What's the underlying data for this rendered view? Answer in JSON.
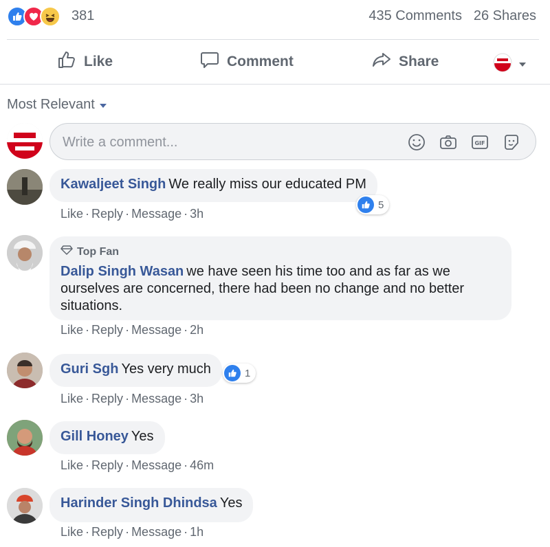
{
  "reactions": {
    "icons": [
      "like-icon",
      "love-icon",
      "haha-icon"
    ],
    "count": "381",
    "comments": "435 Comments",
    "shares": "26 Shares"
  },
  "actions": {
    "like": "Like",
    "comment": "Comment",
    "share": "Share"
  },
  "sort": {
    "label": "Most Relevant"
  },
  "composer": {
    "placeholder": "Write a comment..."
  },
  "comments": [
    {
      "author": "Kawaljeet Singh",
      "text": "We really miss our educated PM",
      "time": "3h",
      "likes": "5",
      "badge": ""
    },
    {
      "author": "Dalip Singh Wasan",
      "badge": "Top Fan",
      "text": "we have seen his time too and as far as we ourselves are concerned, there had been no change and no better situations.",
      "time": "2h",
      "likes": ""
    },
    {
      "author": "Guri Sgh",
      "text": "Yes very much",
      "time": "3h",
      "likes": "1",
      "badge": ""
    },
    {
      "author": "Gill Honey",
      "text": "Yes",
      "time": "46m",
      "likes": "",
      "badge": ""
    },
    {
      "author": "Harinder Singh Dhindsa",
      "text": "Yes",
      "time": "1h",
      "likes": "",
      "badge": ""
    }
  ],
  "comment_actions": {
    "like": "Like",
    "reply": "Reply",
    "message": "Message",
    "sep": "·"
  },
  "colors": {
    "link": "#385898",
    "like_blue": "#2f80ed",
    "love_red": "#f0284a",
    "haha_yellow": "#f7c84a"
  }
}
